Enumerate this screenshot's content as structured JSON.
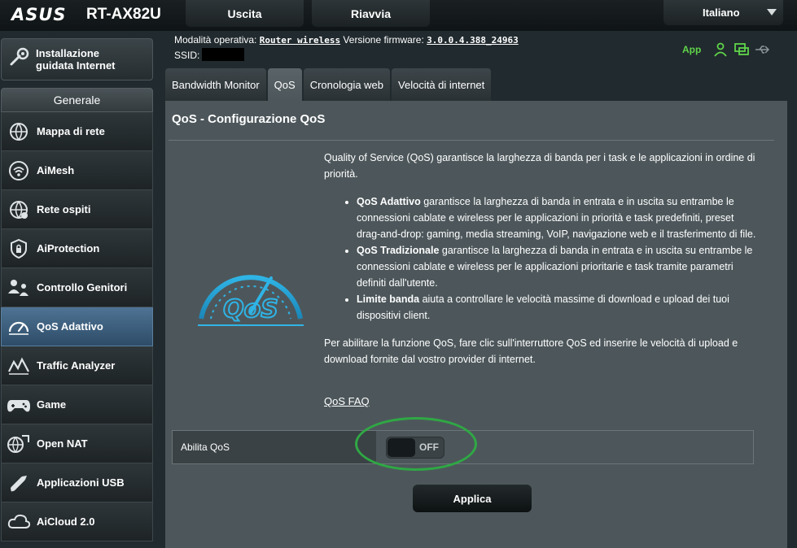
{
  "header": {
    "brand": "ASUS",
    "model": "RT-AX82U",
    "logout_label": "Uscita",
    "reboot_label": "Riavvia",
    "language": "Italiano"
  },
  "status": {
    "mode_label": "Modalità operativa:",
    "mode_value": "Router wireless",
    "firmware_label": "Versione firmware:",
    "firmware_value": "3.0.0.4.388_24963",
    "ssid_label": "SSID:",
    "app_label": "App",
    "icons": [
      "user-icon",
      "network-monitor-icon",
      "usb-icon"
    ]
  },
  "sidebar": {
    "quick_setup_line1": "Installazione",
    "quick_setup_line2": "guidata Internet",
    "section_title": "Generale",
    "items": [
      {
        "label": "Mappa di rete",
        "icon": "network-map-icon",
        "active": false
      },
      {
        "label": "AiMesh",
        "icon": "aimesh-icon",
        "active": false
      },
      {
        "label": "Rete ospiti",
        "icon": "guest-network-icon",
        "active": false
      },
      {
        "label": "AiProtection",
        "icon": "shield-icon",
        "active": false
      },
      {
        "label": "Controllo Genitori",
        "icon": "parental-control-icon",
        "active": false
      },
      {
        "label": "QoS Adattivo",
        "icon": "speedometer-icon",
        "active": true
      },
      {
        "label": "Traffic Analyzer",
        "icon": "traffic-analyzer-icon",
        "active": false
      },
      {
        "label": "Game",
        "icon": "gamepad-icon",
        "active": false
      },
      {
        "label": "Open NAT",
        "icon": "open-nat-icon",
        "active": false
      },
      {
        "label": "Applicazioni USB",
        "icon": "usb-application-icon",
        "active": false
      },
      {
        "label": "AiCloud 2.0",
        "icon": "cloud-icon",
        "active": false
      }
    ]
  },
  "tabs": [
    {
      "label": "Bandwidth Monitor",
      "active": false
    },
    {
      "label": "QoS",
      "active": true
    },
    {
      "label": "Cronologia web",
      "active": false
    },
    {
      "label": "Velocità di internet",
      "active": false
    }
  ],
  "main": {
    "title": "QoS - Configurazione QoS",
    "graphic_text": "QoS",
    "intro": "Quality of Service (QoS) garantisce la larghezza di banda per i task e le applicazioni in ordine di priorità.",
    "bullets": [
      {
        "bold": "QoS Adattivo",
        "text": " garantisce la larghezza di banda in entrata e in uscita su entrambe le connessioni cablate e wireless per le applicazioni in priorità e task predefiniti, preset drag-and-drop: gaming, media streaming, VoIP, navigazione web e il trasferimento di file."
      },
      {
        "bold": "QoS Tradizionale",
        "text": " garantisce la larghezza di banda in entrata e in uscita su entrambe le connessioni cablate e wireless per le applicazioni prioritarie e task tramite parametri definiti dall'utente."
      },
      {
        "bold": "Limite banda",
        "text": " aiuta a controllare le velocità massime di download e upload dei tuoi dispositivi client."
      }
    ],
    "enable_note": "Per abilitare la funzione QoS, fare clic sull'interruttore QoS ed inserire le velocità di upload e download fornite dal vostro provider di internet.",
    "faq_label": "QoS FAQ",
    "enable_label": "Abilita QoS",
    "toggle_state": "OFF",
    "apply_label": "Applica"
  },
  "colors": {
    "highlight": "#2fa844",
    "app_link": "#5fd44a",
    "active_nav": "#4f7394",
    "gauge": "#2fb4e6"
  }
}
